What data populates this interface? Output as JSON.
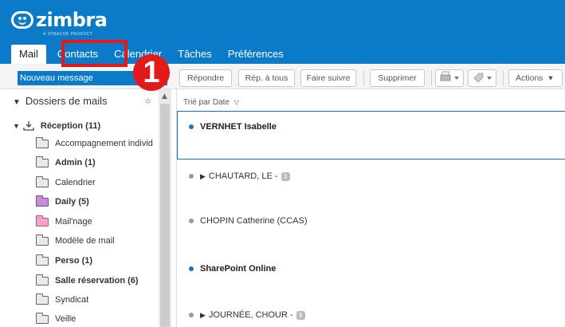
{
  "app": {
    "logo_text": "zimbra",
    "logo_sub": "A SYNACOR PRODUCT"
  },
  "tabs": [
    {
      "label": "Mail"
    },
    {
      "label": "Contacts"
    },
    {
      "label": "Calendrier"
    },
    {
      "label": "Tâches"
    },
    {
      "label": "Préférences"
    }
  ],
  "annotation": {
    "step_number": "1",
    "color": "#e21a1a"
  },
  "toolbar": {
    "new_message": "Nouveau message",
    "reply": "Répondre",
    "reply_all": "Rép. à tous",
    "forward": "Faire suivre",
    "delete": "Supprimer",
    "actions": "Actions",
    "print_icon": "printer-icon",
    "tag_icon": "tag-icon",
    "dropdown_glyph": "▾"
  },
  "sidebar": {
    "header": "Dossiers de mails",
    "folders": [
      {
        "label": "Réception (11)"
      },
      {
        "label": "Accompagnement individ"
      },
      {
        "label": "Admin (1)"
      },
      {
        "label": "Calendrier"
      },
      {
        "label": "Daily (5)"
      },
      {
        "label": "Mail'nage"
      },
      {
        "label": "Modèle de mail"
      },
      {
        "label": "Perso (1)"
      },
      {
        "label": "Salle réservation (6)"
      },
      {
        "label": "Syndicat"
      },
      {
        "label": "Veille"
      }
    ]
  },
  "messages": {
    "sort_label": "Trié par Date",
    "items": [
      {
        "sender": "VERNHET Isabelle",
        "count": ""
      },
      {
        "sender": "CHAUTARD, LE - ",
        "count": "3"
      },
      {
        "sender": "CHOPIN Catherine (CCAS)",
        "count": ""
      },
      {
        "sender": "SharePoint Online",
        "count": ""
      },
      {
        "sender": "JOURNÉE, CHOUR - ",
        "count": "9"
      }
    ]
  },
  "colors": {
    "brand": "#0a7ac9",
    "selection": "#1e73be"
  }
}
